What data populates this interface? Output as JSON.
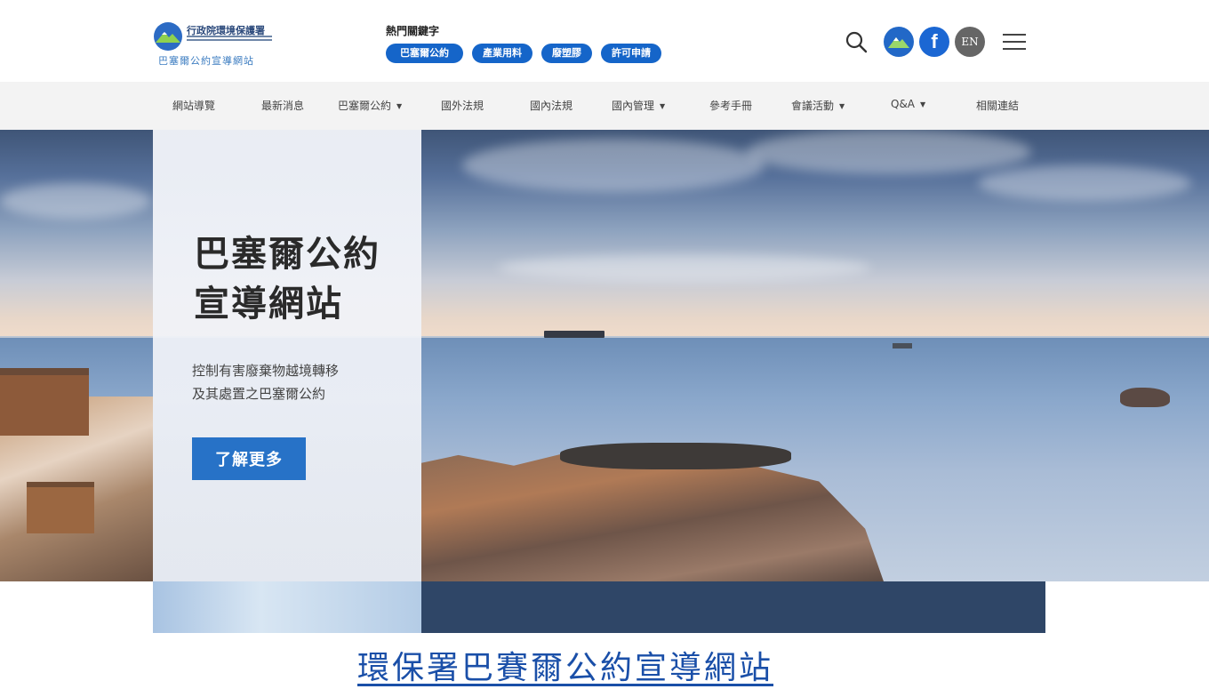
{
  "header": {
    "logo": {
      "org_name": "行政院環境保護署",
      "subtitle": "巴塞爾公約宣導網站"
    },
    "hot_keywords": {
      "title": "熱門關鍵字",
      "tags": [
        "巴塞爾公約",
        "產業用料",
        "廢塑膠",
        "許可申請"
      ]
    },
    "tools": {
      "search_icon": "search-icon",
      "language_label": "EN",
      "facebook_label": "f"
    }
  },
  "nav": {
    "items": [
      {
        "label": "網站導覽",
        "dropdown": false
      },
      {
        "label": "最新消息",
        "dropdown": false
      },
      {
        "label": "巴塞爾公約",
        "dropdown": true
      },
      {
        "label": "國外法規",
        "dropdown": false
      },
      {
        "label": "國內法規",
        "dropdown": false
      },
      {
        "label": "國內管理",
        "dropdown": true
      },
      {
        "label": "參考手冊",
        "dropdown": false
      },
      {
        "label": "會議活動",
        "dropdown": true
      },
      {
        "label": "Q&A",
        "dropdown": true
      },
      {
        "label": "相關連結",
        "dropdown": false
      }
    ]
  },
  "hero": {
    "title_line1": "巴塞爾公約",
    "title_line2": "宣導網站",
    "subtitle_line1": "控制有害廢棄物越境轉移",
    "subtitle_line2": "及其處置之巴塞爾公約",
    "button_label": "了解更多"
  },
  "caption": {
    "text": "環保署巴賽爾公約宣導網站"
  },
  "colors": {
    "accent": "#1565c9",
    "hero_button": "#2772c7",
    "dark_strip": "#2f4667",
    "caption_link": "#1a4fa8"
  }
}
